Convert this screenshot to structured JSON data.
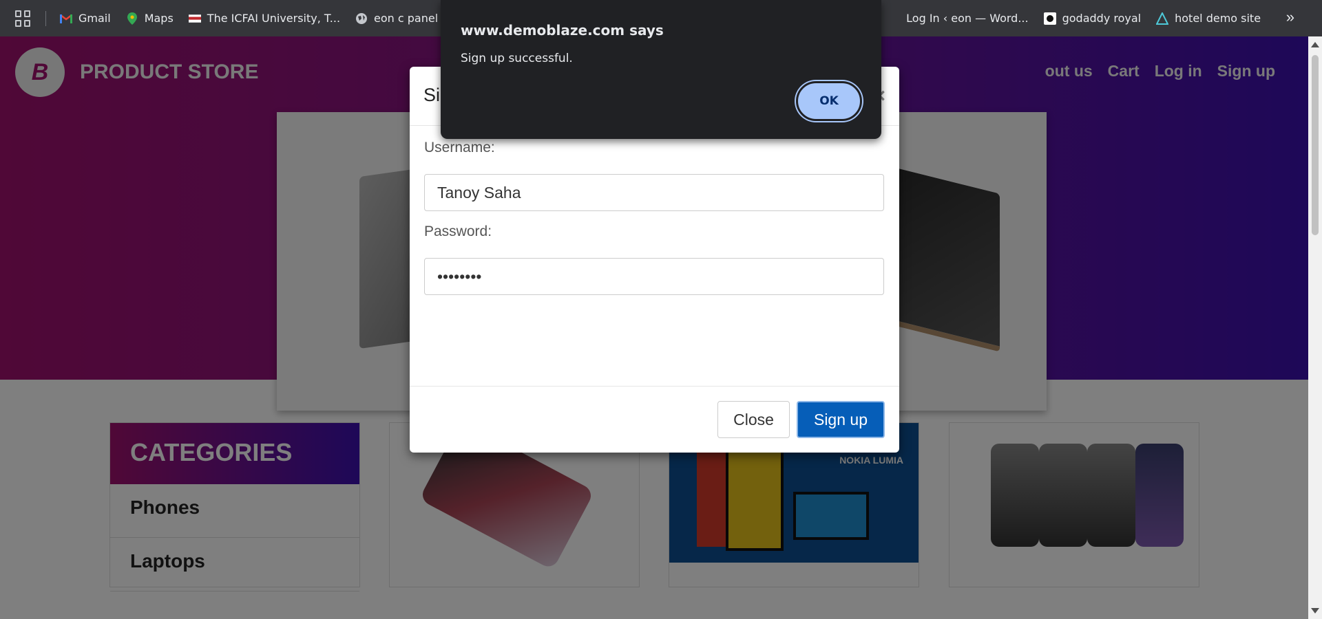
{
  "bookmarks": {
    "items": [
      {
        "label": "Gmail",
        "icon": "gmail-icon"
      },
      {
        "label": "Maps",
        "icon": "maps-icon"
      },
      {
        "label": "The ICFAI University, T...",
        "icon": "icfai-icon"
      },
      {
        "label": "eon c panel",
        "icon": "globe-icon"
      },
      {
        "label": "Log In ‹ eon — Word...",
        "icon": "wordpress-icon"
      },
      {
        "label": "godaddy royal",
        "icon": "godaddy-icon"
      },
      {
        "label": "hotel demo site",
        "icon": "hotel-icon"
      }
    ],
    "more": "»"
  },
  "site": {
    "brand": "PRODUCT STORE",
    "logo_letter": "B",
    "nav": [
      "out us",
      "Cart",
      "Log in",
      "Sign up"
    ],
    "prev": "‹",
    "next": "›"
  },
  "categories": {
    "title": "CATEGORIES",
    "items": [
      "Phones",
      "Laptops"
    ]
  },
  "cards": {
    "nokia_text": "NOKIA LUMIA"
  },
  "modal": {
    "title": "Si",
    "close_x": "×",
    "username_label": "Username:",
    "username_value": "Tanoy Saha",
    "password_label": "Password:",
    "password_value": "••••••••",
    "close_label": "Close",
    "signup_label": "Sign up"
  },
  "alert": {
    "title": "www.demoblaze.com says",
    "message": "Sign up successful.",
    "ok": "OK"
  },
  "colors": {
    "accent": "#065eb8",
    "alert_button": "#a8c7fa",
    "hero_start": "#a0106e",
    "hero_end": "#3c10b0"
  }
}
